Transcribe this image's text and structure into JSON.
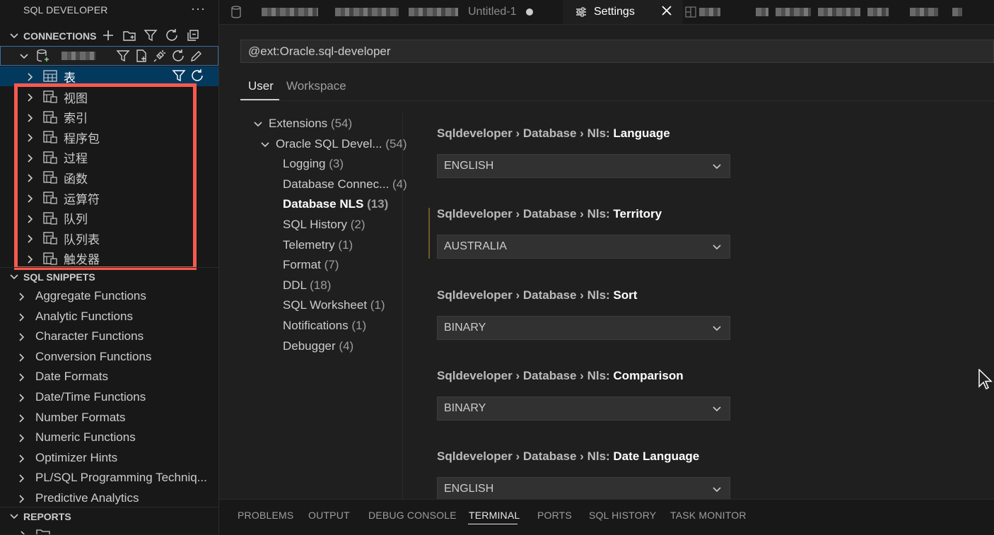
{
  "sidebar": {
    "title": "SQL DEVELOPER",
    "more": "···",
    "connections_header": "CONNECTIONS",
    "selected_item": "表",
    "object_items": [
      {
        "label": "视图",
        "icon": "view-icon"
      },
      {
        "label": "索引",
        "icon": "index-icon"
      },
      {
        "label": "程序包",
        "icon": "package-icon"
      },
      {
        "label": "过程",
        "icon": "procedure-icon"
      },
      {
        "label": "函数",
        "icon": "function-icon"
      },
      {
        "label": "运算符",
        "icon": "operator-icon"
      },
      {
        "label": "队列",
        "icon": "queue-icon"
      },
      {
        "label": "队列表",
        "icon": "queue-table-icon"
      },
      {
        "label": "触发器",
        "icon": "trigger-icon"
      }
    ],
    "snippets_header": "SQL SNIPPETS",
    "snippets": [
      "Aggregate Functions",
      "Analytic Functions",
      "Character Functions",
      "Conversion Functions",
      "Date Formats",
      "Date/Time Functions",
      "Number Formats",
      "Numeric Functions",
      "Optimizer Hints",
      "PL/SQL Programming Techniq...",
      "Predictive Analytics"
    ],
    "reports_header": "REPORTS"
  },
  "tabs": {
    "untitled": "Untitled-1",
    "settings": "Settings"
  },
  "settings": {
    "search_value": "@ext:Oracle.sql-developer",
    "scope_tabs": [
      "User",
      "Workspace"
    ],
    "toc": [
      {
        "label": "Extensions",
        "count": "(54)"
      },
      {
        "label": "Oracle SQL Devel...",
        "count": "(54)"
      },
      {
        "label": "Logging",
        "count": "(3)"
      },
      {
        "label": "Database Connec...",
        "count": "(4)"
      },
      {
        "label": "Database NLS",
        "count": "(13)"
      },
      {
        "label": "SQL History",
        "count": "(2)"
      },
      {
        "label": "Telemetry",
        "count": "(1)"
      },
      {
        "label": "Format",
        "count": "(7)"
      },
      {
        "label": "DDL",
        "count": "(18)"
      },
      {
        "label": "SQL Worksheet",
        "count": "(1)"
      },
      {
        "label": "Notifications",
        "count": "(1)"
      },
      {
        "label": "Debugger",
        "count": "(4)"
      }
    ],
    "items": [
      {
        "prefix": "Sqldeveloper › Database › Nls: ",
        "key": "Language",
        "value": "ENGLISH"
      },
      {
        "prefix": "Sqldeveloper › Database › Nls: ",
        "key": "Territory",
        "value": "AUSTRALIA"
      },
      {
        "prefix": "Sqldeveloper › Database › Nls: ",
        "key": "Sort",
        "value": "BINARY"
      },
      {
        "prefix": "Sqldeveloper › Database › Nls: ",
        "key": "Comparison",
        "value": "BINARY"
      },
      {
        "prefix": "Sqldeveloper › Database › Nls: ",
        "key": "Date Language",
        "value": "ENGLISH"
      }
    ]
  },
  "panel": {
    "tabs": [
      "PROBLEMS",
      "OUTPUT",
      "DEBUG CONSOLE",
      "TERMINAL",
      "PORTS",
      "SQL HISTORY",
      "TASK MONITOR"
    ],
    "active": "TERMINAL"
  },
  "colors": {
    "highlight_box": "#f55a4f",
    "selection": "#04395e",
    "accent_border": "#3a6ea5"
  }
}
